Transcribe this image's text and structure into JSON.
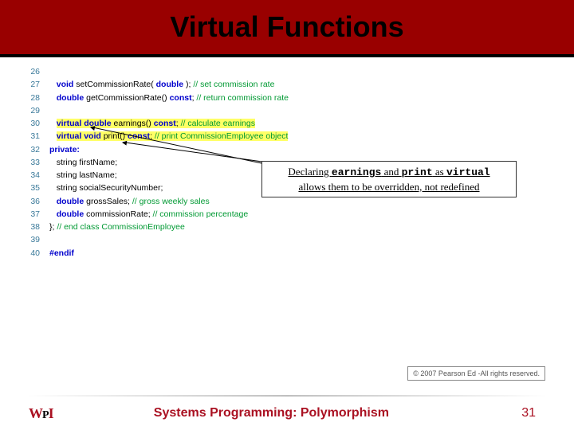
{
  "header": {
    "title": "Virtual Functions"
  },
  "code": {
    "lines": [
      {
        "n": "26",
        "html": ""
      },
      {
        "n": "27",
        "html": "   <span class='kw'>void</span> setCommissionRate( <span class='kw'>double</span> ); <span class='cm'>// set commission rate</span>"
      },
      {
        "n": "28",
        "html": "   <span class='kw'>double</span> getCommissionRate() <span class='kw'>const</span>; <span class='cm'>// return commission rate</span>"
      },
      {
        "n": "29",
        "html": ""
      },
      {
        "n": "30",
        "html": "   <span class='hl'><span class='kw'>virtual double</span> earnings() <span class='kw'>const</span>; <span class='cm'>// calculate earnings</span></span>"
      },
      {
        "n": "31",
        "html": "   <span class='hl'><span class='kw'>virtual void</span> print() <span class='kw'>const</span>; <span class='cm'>// print CommissionEmployee object</span></span>"
      },
      {
        "n": "32",
        "html": "<span class='kw'>private:</span>"
      },
      {
        "n": "33",
        "html": "   string firstName;"
      },
      {
        "n": "34",
        "html": "   string lastName;"
      },
      {
        "n": "35",
        "html": "   string socialSecurityNumber;"
      },
      {
        "n": "36",
        "html": "   <span class='kw'>double</span> grossSales; <span class='cm'>// gross weekly sales</span>"
      },
      {
        "n": "37",
        "html": "   <span class='kw'>double</span> commissionRate; <span class='cm'>// commission percentage</span>"
      },
      {
        "n": "38",
        "html": "}; <span class='cm'>// end class CommissionEmployee</span>"
      },
      {
        "n": "39",
        "html": ""
      },
      {
        "n": "40",
        "html": "<span class='kw'>#endif</span>"
      }
    ]
  },
  "callout": {
    "pre": "Declaring ",
    "fn1": "earnings",
    "mid1": " and ",
    "fn2": "print",
    "mid2": " as ",
    "kw": "virtual",
    "line2": "allows them to be overridden, not redefined"
  },
  "copyright": "© 2007 Pearson Ed -All rights reserved.",
  "footer": {
    "logo_w": "W",
    "logo_p": "P",
    "logo_i": "I",
    "title": "Systems Programming:  Polymorphism",
    "page": "31"
  }
}
